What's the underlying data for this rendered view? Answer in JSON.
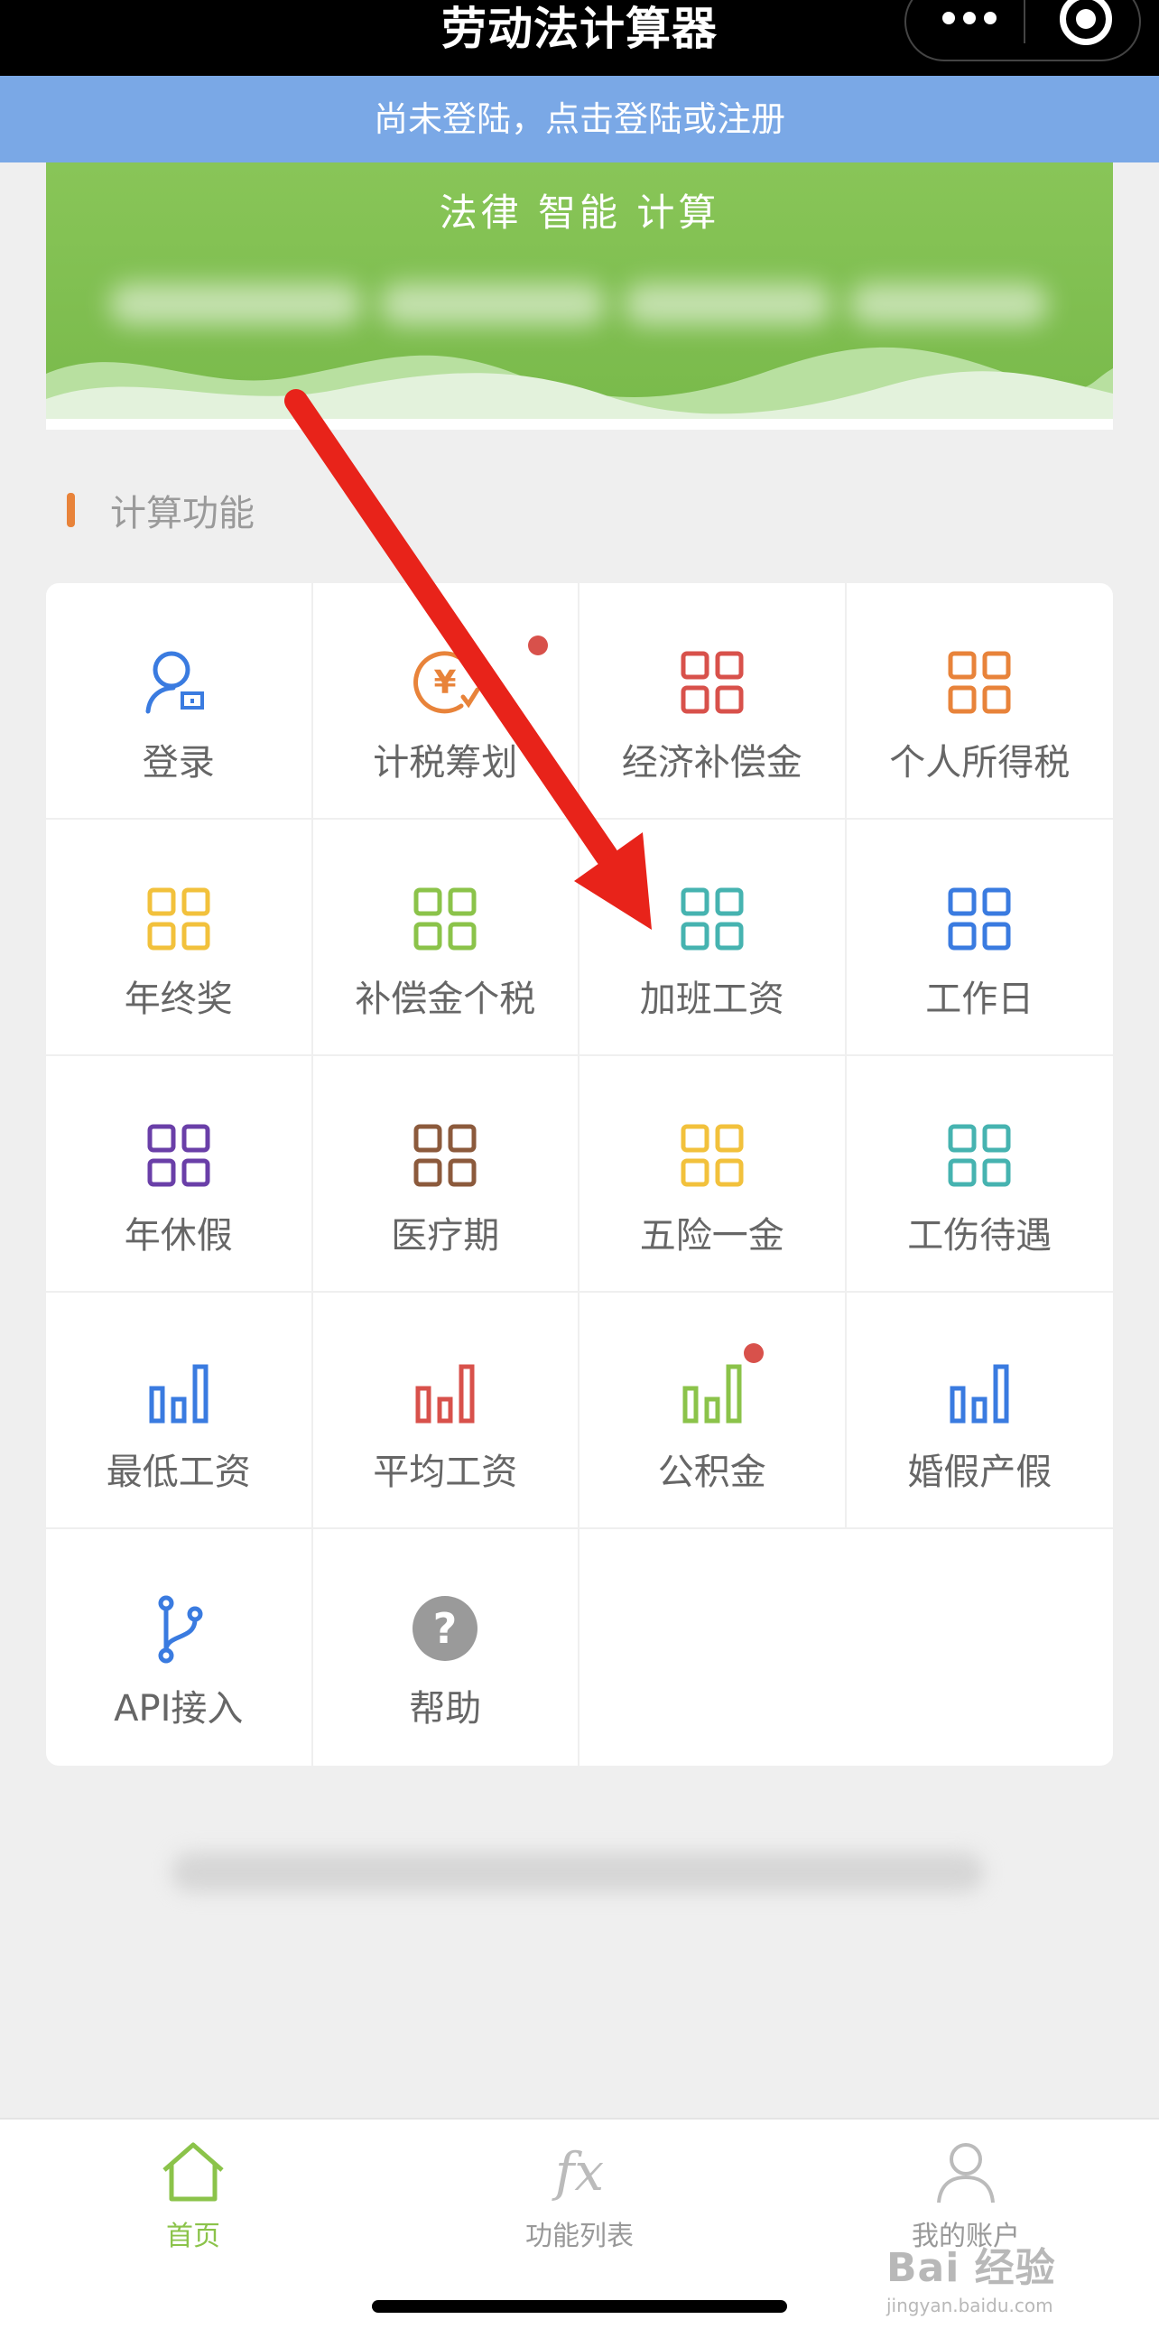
{
  "navbar": {
    "title": "劳动法计算器",
    "more_icon": "more-dots-icon",
    "close_icon": "target-icon"
  },
  "login_banner": "尚未登陆，点击登陆或注册",
  "hero": {
    "title": "法律 智能 计算"
  },
  "section": {
    "title": "计算功能"
  },
  "grid": [
    {
      "label": "登录",
      "icon": "user-login-icon",
      "color": "#3a7be0"
    },
    {
      "label": "计税筹划",
      "icon": "tax-yen-icon",
      "color": "#e8833a",
      "badge": true
    },
    {
      "label": "经济补偿金",
      "icon": "grid-icon",
      "color": "#d8514b"
    },
    {
      "label": "个人所得税",
      "icon": "grid-icon",
      "color": "#e8833a"
    },
    {
      "label": "年终奖",
      "icon": "grid-icon",
      "color": "#f2c13c"
    },
    {
      "label": "补偿金个税",
      "icon": "grid-icon",
      "color": "#8bc34a"
    },
    {
      "label": "加班工资",
      "icon": "grid-icon",
      "color": "#46b3b0"
    },
    {
      "label": "工作日",
      "icon": "grid-icon",
      "color": "#3a7be0"
    },
    {
      "label": "年休假",
      "icon": "grid-icon",
      "color": "#6a3fa8"
    },
    {
      "label": "医疗期",
      "icon": "grid-icon",
      "color": "#8c5a3c"
    },
    {
      "label": "五险一金",
      "icon": "grid-icon",
      "color": "#f2c13c"
    },
    {
      "label": "工伤待遇",
      "icon": "grid-icon",
      "color": "#46b3b0"
    },
    {
      "label": "最低工资",
      "icon": "bar-chart-icon",
      "color": "#3a7be0"
    },
    {
      "label": "平均工资",
      "icon": "bar-chart-icon",
      "color": "#d8514b"
    },
    {
      "label": "公积金",
      "icon": "bar-chart-icon",
      "color": "#8bc34a",
      "badge": true
    },
    {
      "label": "婚假产假",
      "icon": "bar-chart-icon",
      "color": "#3a7be0"
    },
    {
      "label": "API接入",
      "icon": "branch-icon",
      "color": "#3a7be0"
    },
    {
      "label": "帮助",
      "icon": "question-icon",
      "color": "#9a9a9a"
    }
  ],
  "tabs": [
    {
      "label": "首页",
      "icon": "home-icon",
      "active": true
    },
    {
      "label": "功能列表",
      "icon": "fx-icon",
      "glyph": "fx"
    },
    {
      "label": "我的账户",
      "icon": "user-icon"
    }
  ],
  "watermark": {
    "main": "Bai 经验",
    "sub": "jingyan.baidu.com"
  },
  "colors": {
    "accent": "#8bc34a",
    "banner": "#7aa8e6",
    "hero": "#7ab94a",
    "arrow": "#e8231a"
  }
}
